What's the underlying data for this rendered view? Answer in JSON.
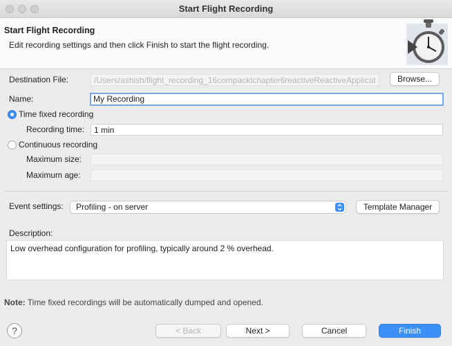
{
  "window": {
    "title": "Start Flight Recording"
  },
  "header": {
    "title": "Start Flight Recording",
    "description": "Edit recording settings and then click Finish to start the flight recording."
  },
  "form": {
    "destination_label": "Destination File:",
    "destination_value": "/Users/ashish/flight_recording_16compacktchapter6reactiveReactiveApplicat",
    "browse_label": "Browse...",
    "name_label": "Name:",
    "name_value": "My Recording",
    "time_fixed_label": "Time fixed recording",
    "recording_time_label": "Recording time:",
    "recording_time_value": "1 min",
    "continuous_label": "Continuous recording",
    "max_size_label": "Maximum size:",
    "max_age_label": "Maximum age:",
    "event_settings_label": "Event settings:",
    "event_settings_value": "Profiling - on server",
    "template_manager_label": "Template Manager",
    "description_label": "Description:",
    "description_value": "Low overhead configuration for profiling, typically around 2 % overhead.",
    "note_prefix": "Note:",
    "note_text": " Time fixed recordings will be automatically dumped and opened."
  },
  "footer": {
    "help_glyph": "?",
    "back_label": "< Back",
    "next_label": "Next >",
    "cancel_label": "Cancel",
    "finish_label": "Finish"
  },
  "colors": {
    "accent": "#3b8ff5",
    "focus_ring": "#7aa6e0"
  }
}
